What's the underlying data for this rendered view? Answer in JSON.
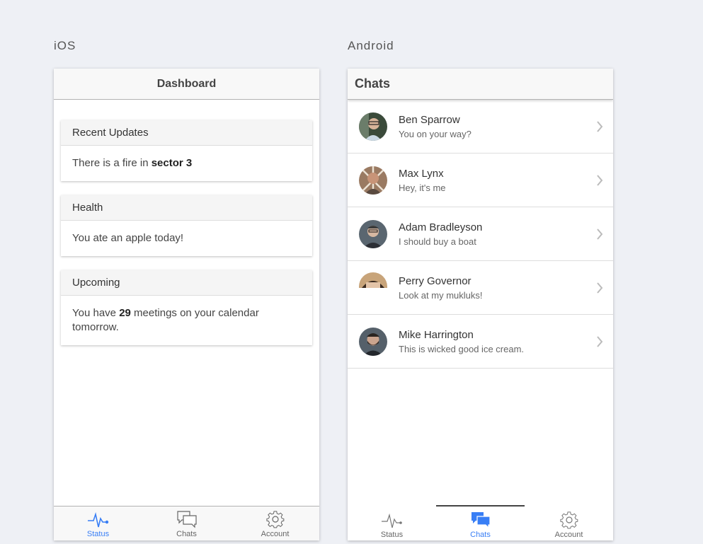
{
  "labels": {
    "ios": "iOS",
    "android": "Android"
  },
  "ios": {
    "title": "Dashboard",
    "cards": [
      {
        "header": "Recent Updates",
        "pre": "There is a fire in ",
        "strong": "sector 3",
        "post": ""
      },
      {
        "header": "Health",
        "pre": "You ate an apple today!",
        "strong": "",
        "post": ""
      },
      {
        "header": "Upcoming",
        "pre": "You have ",
        "strong": "29",
        "post": " meetings on your calendar tomorrow."
      }
    ],
    "tabs": [
      {
        "label": "Status",
        "icon": "pulse-icon",
        "active": true
      },
      {
        "label": "Chats",
        "icon": "chat-bubbles-icon",
        "active": false
      },
      {
        "label": "Account",
        "icon": "gear-icon",
        "active": false
      }
    ]
  },
  "android": {
    "title": "Chats",
    "chats": [
      {
        "name": "Ben Sparrow",
        "message": "You on your way?"
      },
      {
        "name": "Max Lynx",
        "message": "Hey, it's me"
      },
      {
        "name": "Adam Bradleyson",
        "message": "I should buy a boat"
      },
      {
        "name": "Perry Governor",
        "message": "Look at my mukluks!"
      },
      {
        "name": "Mike Harrington",
        "message": "This is wicked good ice cream."
      }
    ],
    "tabs": [
      {
        "label": "Status",
        "icon": "pulse-icon",
        "active": false
      },
      {
        "label": "Chats",
        "icon": "chat-bubbles-icon",
        "active": true
      },
      {
        "label": "Account",
        "icon": "gear-icon",
        "active": false
      }
    ]
  },
  "colors": {
    "accent": "#387ef5",
    "background": "#eef0f5"
  }
}
